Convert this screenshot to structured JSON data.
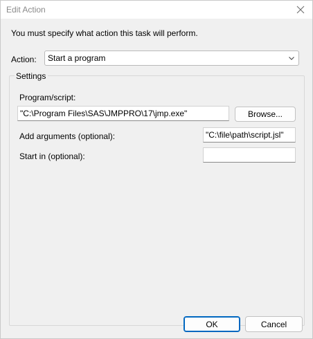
{
  "window": {
    "title": "Edit Action"
  },
  "instruction": "You must specify what action this task will perform.",
  "action": {
    "label": "Action:",
    "selected": "Start a program"
  },
  "settings": {
    "legend": "Settings",
    "program_label": "Program/script:",
    "program_value": "\"C:\\Program Files\\SAS\\JMPPRO\\17\\jmp.exe\"",
    "browse_label": "Browse...",
    "arguments_label": "Add arguments (optional):",
    "arguments_value": "\"C:\\file\\path\\script.jsl\"",
    "start_in_label": "Start in (optional):",
    "start_in_value": ""
  },
  "buttons": {
    "ok": "OK",
    "cancel": "Cancel"
  },
  "icons": {
    "close": "close-icon",
    "dropdown": "chevron-down-icon"
  },
  "colors": {
    "accent": "#0067c0",
    "dialog_bg": "#f0f0f0"
  }
}
